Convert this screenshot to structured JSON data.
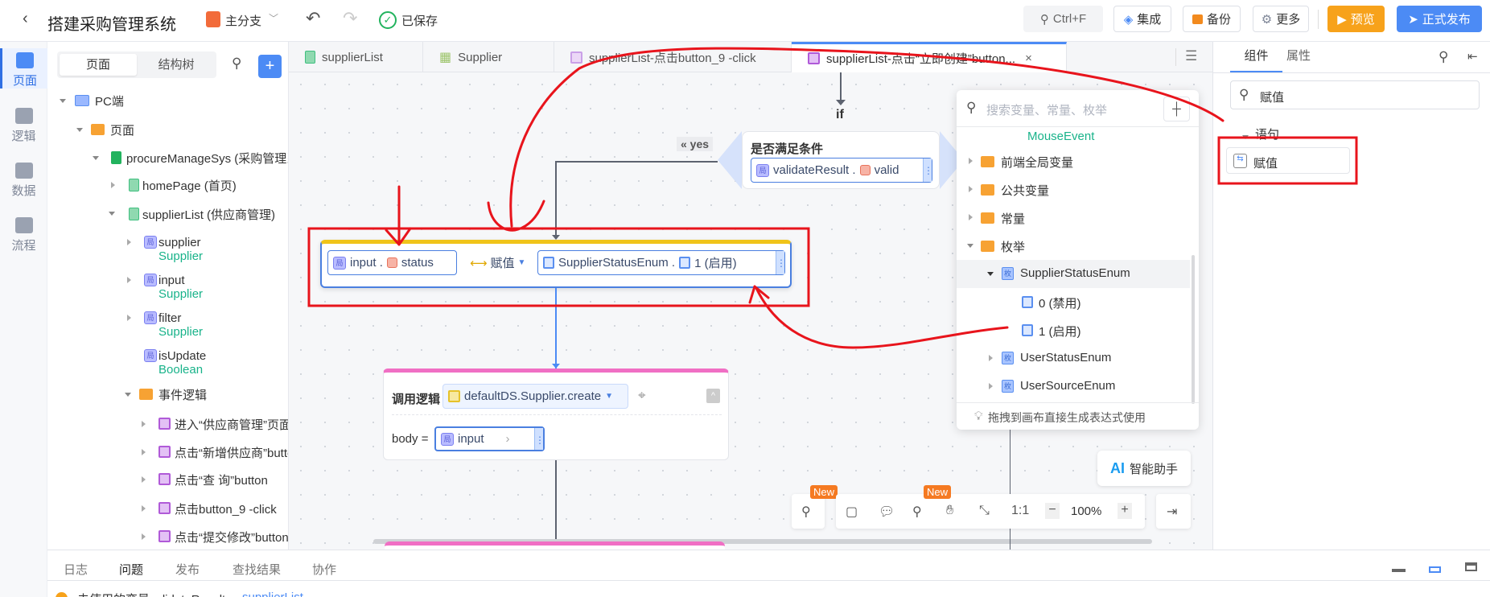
{
  "header": {
    "title": "搭建采购管理系统",
    "branch": "主分支",
    "saved": "已保存",
    "search_shortcut": "Ctrl+F",
    "integrate": "集成",
    "backup": "备份",
    "more": "更多",
    "preview": "预览",
    "publish": "正式发布"
  },
  "colors": {
    "accent": "#4c8bf5",
    "preview": "#f7a21b",
    "annotation": "#e8141c",
    "assign_top": "#f0c419",
    "call_top": "#f06fc4"
  },
  "sidebar": {
    "items": [
      {
        "label": "页面",
        "icon": "layout-icon"
      },
      {
        "label": "逻辑",
        "icon": "logic-icon"
      },
      {
        "label": "数据",
        "icon": "data-icon"
      },
      {
        "label": "流程",
        "icon": "flow-icon"
      }
    ]
  },
  "tree": {
    "tabs": [
      "页面",
      "结构树"
    ],
    "pc": "PC端",
    "pages": "页面",
    "app": "procureManageSys (采购管理系统)",
    "home": "homePage (首页)",
    "supplierList": "supplierList (供应商管理)",
    "vars": [
      {
        "name": "supplier",
        "type": "Supplier"
      },
      {
        "name": "input",
        "type": "Supplier"
      },
      {
        "name": "filter",
        "type": "Supplier"
      },
      {
        "name": "isUpdate",
        "type": "Boolean"
      }
    ],
    "events_folder": "事件逻辑",
    "events": [
      "进入“供应商管理”页面",
      "点击“新增供应商”button",
      "点击“查 询”button",
      "点击button_9 -click",
      "点击“提交修改”button"
    ]
  },
  "tabs": [
    "supplierList",
    "Supplier",
    "supplierList-点击button_9 -click",
    "supplierList-点击“立即创建”button..."
  ],
  "canvas": {
    "if_label": "if",
    "yes_label": "« yes",
    "condition_title": "是否满足条件",
    "condition_var": "validateResult .",
    "condition_field": "valid",
    "assign": {
      "left_var": "input .",
      "left_field": "status",
      "op": "赋值",
      "right_enum": "SupplierStatusEnum .",
      "right_value": "1 (启用)"
    },
    "call": {
      "label": "调用逻辑",
      "target": "defaultDS.Supplier.create",
      "body_label": "body =",
      "body_var": "input"
    },
    "toolbar": {
      "new1": "New",
      "new2": "New",
      "ratio": "1:1",
      "zoom": "100%"
    },
    "ai_label": "智能助手",
    "ai_icon": "AI"
  },
  "popup": {
    "placeholder": "搜索变量、常量、枚举",
    "mouse_event": "MouseEvent",
    "items": [
      "前端全局变量",
      "公共变量",
      "常量",
      "枚举"
    ],
    "enum": "SupplierStatusEnum",
    "values": [
      "0 (禁用)",
      "1 (启用)"
    ],
    "others": [
      "UserStatusEnum",
      "UserSourceEnum"
    ],
    "footer": "拖拽到画布直接生成表达式使用"
  },
  "right": {
    "tabs": [
      "组件",
      "属性"
    ],
    "search": "赋值",
    "group": "语句",
    "item": "赋值"
  },
  "bottom": {
    "tabs": [
      "日志",
      "问题",
      "发布",
      "查找结果",
      "协作"
    ],
    "issue": "未使用的变量validateResult",
    "issue_link": "supplierList"
  }
}
